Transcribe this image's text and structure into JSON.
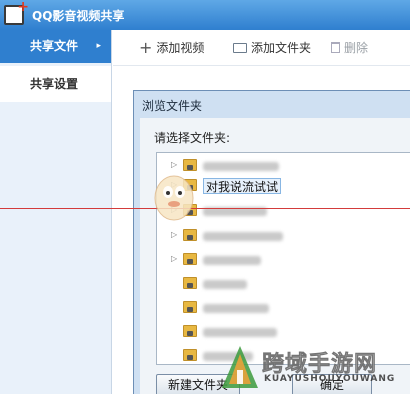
{
  "app": {
    "title": "QQ影音视频共享",
    "logo_icon": "app-logo-icon"
  },
  "sidebar": {
    "items": [
      {
        "label": "共享文件",
        "active": true,
        "arrow": "▸"
      },
      {
        "label": "共享设置",
        "active": false
      }
    ]
  },
  "toolbar": {
    "add_video": "添加视频",
    "add_folder": "添加文件夹",
    "delete": "删除"
  },
  "dialog": {
    "title": "浏览文件夹",
    "prompt": "请选择文件夹:",
    "selected_folder": "对我说流试试",
    "new_folder_button": "新建文件夹",
    "ok_button": "确定"
  },
  "watermark": {
    "text": "跨域手游网",
    "sub": "KUAYUSHOUYOUWANG"
  },
  "colors": {
    "title_bar": "#2f7fcf",
    "sidebar_active": "#2f7fcf",
    "red_line": "#d33b3b",
    "folder": "#e8b842"
  }
}
